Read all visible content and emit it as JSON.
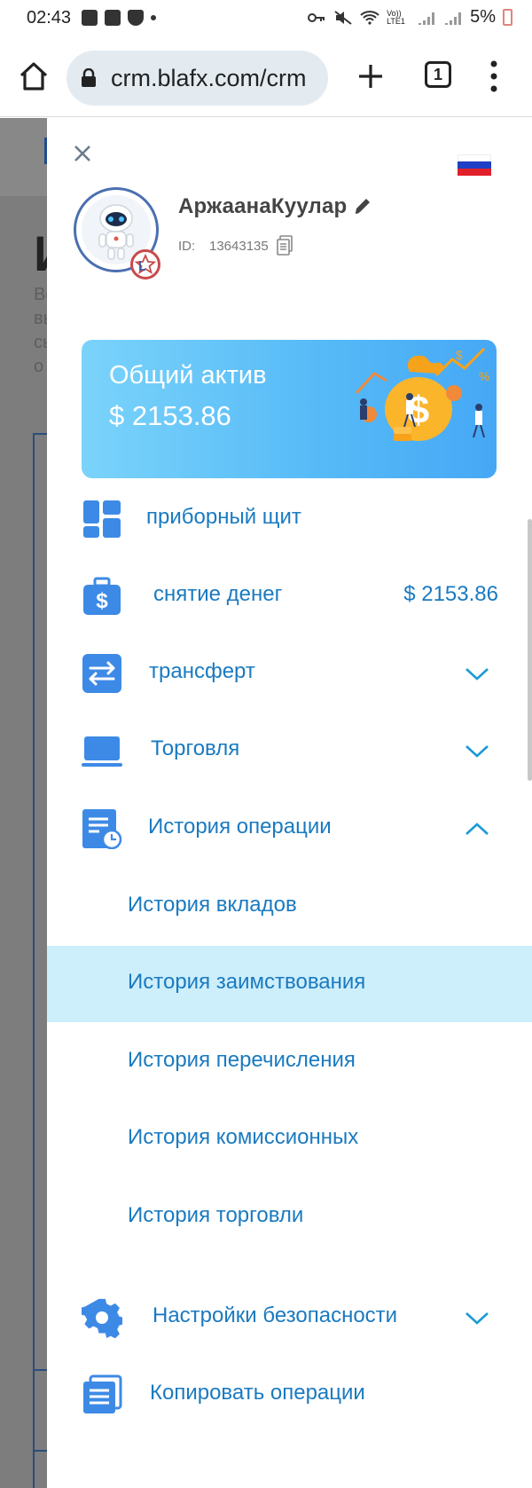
{
  "status_bar": {
    "time": "02:43",
    "battery": "5%",
    "icons": [
      "image-icon",
      "alert-icon",
      "shield-icon",
      "dot-icon",
      "key-icon",
      "mute-icon",
      "wifi-icon",
      "volte-icon",
      "signal-icon",
      "signal-icon",
      "battery-icon"
    ],
    "volte_label": "Vo)) LTE1"
  },
  "browser": {
    "url": "crm.blafx.com/crm",
    "tabs_count": "1",
    "icons": [
      "home-icon",
      "lock-icon",
      "plus-icon",
      "tabs-icon",
      "more-vert-icon"
    ]
  },
  "background_page": {
    "heading_fragment": "И",
    "text_fragments": [
      "Во",
      "вы",
      "сь",
      "о"
    ]
  },
  "drawer": {
    "flag": "russian-flag-icon",
    "user": {
      "name": "АржаанаКуулар",
      "id_label": "ID:",
      "id_value": "13643135"
    },
    "asset_card": {
      "title": "Общий актив",
      "value": "$ 2153.86"
    },
    "nav": [
      {
        "label": "приборный щит",
        "icon": "dashboard-icon"
      },
      {
        "label": "снятие денег",
        "icon": "money-bag-icon",
        "amount": "$ 2153.86"
      },
      {
        "label": "трансферт",
        "icon": "transfer-icon",
        "expandable": true,
        "expanded": false
      },
      {
        "label": "Торговля",
        "icon": "laptop-icon",
        "expandable": true,
        "expanded": false
      },
      {
        "label": "История операции",
        "icon": "history-icon",
        "expandable": true,
        "expanded": true
      },
      {
        "label": "Настройки безопасности",
        "icon": "gear-icon",
        "expandable": true,
        "expanded": false
      },
      {
        "label": "Копировать операции",
        "icon": "copy-docs-icon"
      }
    ],
    "history_sub": [
      {
        "label": "История вкладов",
        "active": false
      },
      {
        "label": "История заимствования",
        "active": true
      },
      {
        "label": "История перечисления",
        "active": false
      },
      {
        "label": "История комиссионных",
        "active": false
      },
      {
        "label": "История торговли",
        "active": false
      }
    ]
  },
  "colors": {
    "accent": "#1a7ac0",
    "active_bg": "#cdeefb",
    "card_gradient_start": "#7ad3fa",
    "card_gradient_end": "#46a8f5",
    "icon_blue": "#3d8ae6"
  }
}
